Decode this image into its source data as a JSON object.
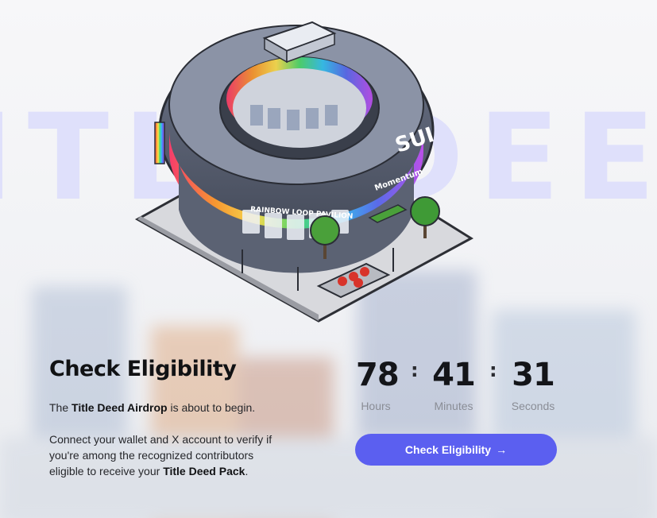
{
  "background_word": "TITLE DEED",
  "illustration": {
    "sign_brand": "SUI",
    "sign_sponsor": "Momentum",
    "sign_pavilion": "RAINBOW LOOP PAVILION"
  },
  "eligibility": {
    "heading": "Check Eligibility",
    "intro_prefix": "The ",
    "intro_bold": "Title Deed Airdrop",
    "intro_suffix": " is about to begin.",
    "body_prefix": "Connect your wallet and X account to verify if you're among the recognized contributors eligible to receive your ",
    "body_bold": "Title Deed Pack",
    "body_suffix": "."
  },
  "countdown": {
    "hours": "78",
    "hours_label": "Hours",
    "minutes": "41",
    "minutes_label": "Minutes",
    "seconds": "31",
    "seconds_label": "Seconds",
    "separator": ":"
  },
  "cta": {
    "label": "Check Eligibility",
    "icon": "arrow-right-icon",
    "arrow_glyph": "→"
  },
  "colors": {
    "accent": "#5b5ff0",
    "background_word": "#dfe0fb",
    "text": "#111214",
    "muted": "#8a8d96"
  }
}
